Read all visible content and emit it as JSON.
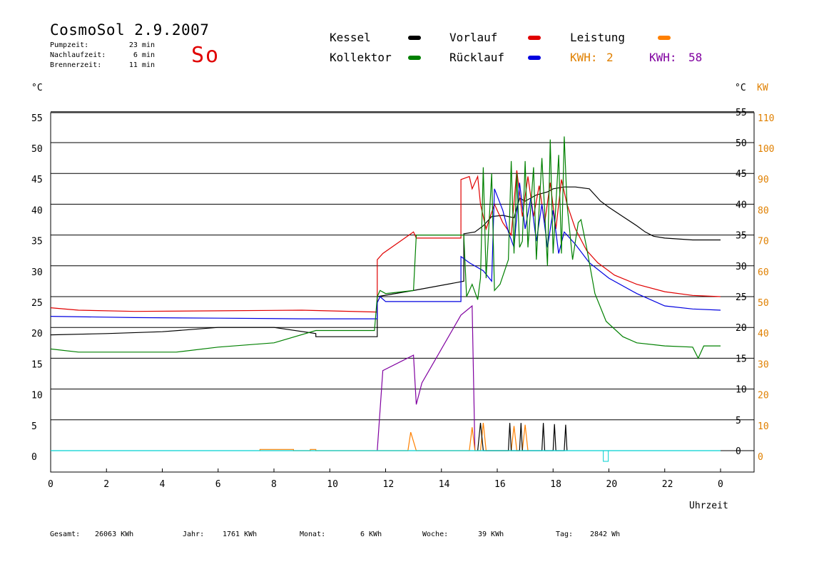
{
  "header": {
    "title": "CosmoSol 2.9.2007",
    "day": "So",
    "stats": [
      {
        "label": "Pumpzeit:",
        "value": "23 min"
      },
      {
        "label": "Nachlaufzeit:",
        "value": "6 min"
      },
      {
        "label": "Brennerzeit:",
        "value": "11 min"
      }
    ]
  },
  "legend": {
    "kessel": {
      "label": "Kessel",
      "color": "#000000"
    },
    "vorlauf": {
      "label": "Vorlauf",
      "color": "#e00000"
    },
    "leistung": {
      "label": "Leistung",
      "color": "#ff8000"
    },
    "kollektor": {
      "label": "Kollektor",
      "color": "#008000"
    },
    "ruecklauf": {
      "label": "Rücklauf",
      "color": "#0000e0"
    },
    "kwh_orange": {
      "label": "KWH:",
      "value": "2",
      "color": "#e08000"
    },
    "kwh_purple": {
      "label": "KWH:",
      "value": "58",
      "color": "#8000a0"
    }
  },
  "axes": {
    "left_unit": "°C",
    "right_unit": "°C",
    "right_unit2": "KW",
    "xlabel": "Uhrzeit"
  },
  "footer": {
    "gesamt": {
      "label": "Gesamt:",
      "value": "26063 KWh"
    },
    "jahr": {
      "label": "Jahr:",
      "value": "1761 KWh"
    },
    "monat": {
      "label": "Monat:",
      "value": "6 KWh"
    },
    "woche": {
      "label": "Woche:",
      "value": "39 KWh"
    },
    "tag": {
      "label": "Tag:",
      "value": "2842 Wh"
    }
  },
  "chart_data": {
    "type": "line",
    "xlim": [
      0,
      24
    ],
    "ylim": [
      -3.5,
      55
    ],
    "y2lim": [
      -7,
      110
    ],
    "x_ticks": [
      "0",
      "2",
      "4",
      "6",
      "8",
      "10",
      "12",
      "14",
      "16",
      "18",
      "20",
      "22",
      "0"
    ],
    "y_ticks": [
      0,
      5,
      10,
      15,
      20,
      25,
      30,
      35,
      40,
      45,
      50,
      55
    ],
    "y2_ticks": [
      0,
      10,
      20,
      30,
      40,
      50,
      60,
      70,
      80,
      90,
      100,
      110
    ],
    "grid": true,
    "series": [
      {
        "name": "Kessel",
        "color": "#000000",
        "points": [
          [
            0,
            18.8
          ],
          [
            2,
            19
          ],
          [
            4,
            19.3
          ],
          [
            6,
            20
          ],
          [
            8,
            20
          ],
          [
            9.5,
            19
          ],
          [
            9.5,
            18.5
          ],
          [
            11.7,
            18.5
          ],
          [
            11.7,
            25
          ],
          [
            13,
            26
          ],
          [
            14.8,
            27.5
          ],
          [
            14.8,
            35.2
          ],
          [
            15.2,
            35.5
          ],
          [
            15.5,
            36.5
          ],
          [
            15.8,
            38
          ],
          [
            16.2,
            38.2
          ],
          [
            16.6,
            37.8
          ],
          [
            16.8,
            41
          ],
          [
            17,
            40.5
          ],
          [
            17.4,
            41.5
          ],
          [
            17.8,
            42
          ],
          [
            18,
            42.5
          ],
          [
            18.4,
            42.8
          ],
          [
            18.8,
            42.8
          ],
          [
            19.3,
            42.5
          ],
          [
            19.5,
            41.5
          ],
          [
            19.7,
            40.5
          ],
          [
            20,
            39.5
          ],
          [
            20.5,
            38
          ],
          [
            21,
            36.5
          ],
          [
            21.3,
            35.5
          ],
          [
            21.6,
            34.8
          ],
          [
            22,
            34.5
          ],
          [
            23,
            34.2
          ],
          [
            24,
            34.2
          ]
        ]
      },
      {
        "name": "Vorlauf",
        "color": "#e00000",
        "points": [
          [
            0,
            23.2
          ],
          [
            1,
            22.8
          ],
          [
            3,
            22.6
          ],
          [
            6,
            22.7
          ],
          [
            9,
            22.8
          ],
          [
            11.7,
            22.5
          ],
          [
            11.7,
            31
          ],
          [
            11.9,
            32
          ],
          [
            13,
            35.5
          ],
          [
            13.1,
            34.5
          ],
          [
            14.7,
            34.5
          ],
          [
            14.7,
            44
          ],
          [
            15,
            44.5
          ],
          [
            15.1,
            42.5
          ],
          [
            15.3,
            44.5
          ],
          [
            15.4,
            40
          ],
          [
            15.6,
            36
          ],
          [
            15.9,
            40
          ],
          [
            16.2,
            37
          ],
          [
            16.5,
            35
          ],
          [
            16.7,
            45.5
          ],
          [
            16.9,
            38
          ],
          [
            17.1,
            44.5
          ],
          [
            17.3,
            38
          ],
          [
            17.5,
            43
          ],
          [
            17.7,
            37
          ],
          [
            17.9,
            43.5
          ],
          [
            18.1,
            36
          ],
          [
            18.3,
            44
          ],
          [
            18.5,
            40
          ],
          [
            18.8,
            36
          ],
          [
            19.2,
            32.5
          ],
          [
            19.6,
            30.5
          ],
          [
            20.2,
            28.5
          ],
          [
            21,
            27
          ],
          [
            22,
            25.8
          ],
          [
            23,
            25.2
          ],
          [
            24,
            25
          ]
        ]
      },
      {
        "name": "Rücklauf",
        "color": "#0000e0",
        "points": [
          [
            0,
            21.8
          ],
          [
            3,
            21.6
          ],
          [
            6,
            21.5
          ],
          [
            9,
            21.4
          ],
          [
            11.7,
            21.4
          ],
          [
            11.7,
            24
          ],
          [
            11.8,
            25
          ],
          [
            12,
            24.2
          ],
          [
            13,
            24.2
          ],
          [
            14.7,
            24.2
          ],
          [
            14.7,
            31.5
          ],
          [
            15,
            30.5
          ],
          [
            15.5,
            29.2
          ],
          [
            15.8,
            27.5
          ],
          [
            15.9,
            42.5
          ],
          [
            16.2,
            39
          ],
          [
            16.4,
            35.5
          ],
          [
            16.6,
            33
          ],
          [
            16.8,
            43.5
          ],
          [
            17,
            36
          ],
          [
            17.2,
            41
          ],
          [
            17.4,
            34
          ],
          [
            17.6,
            40
          ],
          [
            17.8,
            33
          ],
          [
            18,
            39
          ],
          [
            18.2,
            32
          ],
          [
            18.4,
            35.5
          ],
          [
            18.8,
            33.5
          ],
          [
            19.3,
            30.5
          ],
          [
            20,
            28
          ],
          [
            21,
            25.5
          ],
          [
            22,
            23.5
          ],
          [
            23,
            23
          ],
          [
            24,
            22.8
          ]
        ]
      },
      {
        "name": "Kollektor",
        "color": "#008000",
        "points": [
          [
            0,
            16.5
          ],
          [
            1,
            16
          ],
          [
            2,
            16
          ],
          [
            4.5,
            16
          ],
          [
            6,
            16.8
          ],
          [
            8,
            17.5
          ],
          [
            9.5,
            19.5
          ],
          [
            11.6,
            19.5
          ],
          [
            11.7,
            25
          ],
          [
            11.8,
            26
          ],
          [
            12,
            25.5
          ],
          [
            13,
            26
          ],
          [
            13.1,
            35
          ],
          [
            14.7,
            35
          ],
          [
            14.8,
            35
          ],
          [
            14.9,
            25
          ],
          [
            15.1,
            27
          ],
          [
            15.3,
            24.5
          ],
          [
            15.4,
            28
          ],
          [
            15.5,
            46
          ],
          [
            15.6,
            28
          ],
          [
            15.8,
            45
          ],
          [
            15.9,
            26
          ],
          [
            16.1,
            27
          ],
          [
            16.4,
            31
          ],
          [
            16.5,
            47
          ],
          [
            16.6,
            32
          ],
          [
            16.7,
            45
          ],
          [
            16.8,
            33
          ],
          [
            16.9,
            34
          ],
          [
            17,
            47
          ],
          [
            17.1,
            33
          ],
          [
            17.3,
            46
          ],
          [
            17.4,
            31
          ],
          [
            17.6,
            47.5
          ],
          [
            17.8,
            30
          ],
          [
            17.9,
            50.5
          ],
          [
            18,
            32
          ],
          [
            18.2,
            48
          ],
          [
            18.3,
            32
          ],
          [
            18.4,
            51
          ],
          [
            18.5,
            40
          ],
          [
            18.7,
            31
          ],
          [
            18.9,
            37
          ],
          [
            19,
            37.5
          ],
          [
            19.2,
            33
          ],
          [
            19.5,
            25.5
          ],
          [
            19.9,
            21
          ],
          [
            20.5,
            18.5
          ],
          [
            21,
            17.5
          ],
          [
            22,
            17
          ],
          [
            23,
            16.8
          ],
          [
            23.2,
            15
          ],
          [
            23.4,
            17
          ],
          [
            24,
            17
          ]
        ]
      },
      {
        "name": "Leistung_line",
        "color": "#8000a0",
        "points": [
          [
            11.7,
            0
          ],
          [
            11.9,
            13
          ],
          [
            13,
            15.5
          ],
          [
            13.1,
            7.5
          ],
          [
            13.3,
            11
          ],
          [
            14.7,
            22
          ],
          [
            15.1,
            23.5
          ],
          [
            15.2,
            0
          ]
        ]
      },
      {
        "name": "Leistung_spikes",
        "color": "#ff8000",
        "points": [
          [
            7.5,
            0
          ],
          [
            7.5,
            0.2
          ],
          [
            8.7,
            0.2
          ],
          [
            8.7,
            0
          ],
          [
            9.3,
            0
          ],
          [
            9.3,
            0.2
          ],
          [
            9.5,
            0.2
          ],
          [
            9.5,
            0
          ],
          [
            12.8,
            0
          ],
          [
            12.9,
            3
          ],
          [
            13.1,
            0
          ],
          [
            15.0,
            0
          ],
          [
            15.1,
            3.8
          ],
          [
            15.2,
            0
          ],
          [
            15.4,
            0
          ],
          [
            15.5,
            4.5
          ],
          [
            15.6,
            0
          ],
          [
            16.5,
            0
          ],
          [
            16.6,
            4
          ],
          [
            16.7,
            0
          ],
          [
            16.9,
            0
          ],
          [
            17.0,
            4.2
          ],
          [
            17.1,
            0
          ]
        ]
      },
      {
        "name": "Black_spikes",
        "color": "#000000",
        "points": [
          [
            15.3,
            0
          ],
          [
            15.4,
            4.5
          ],
          [
            15.5,
            0
          ],
          [
            16.4,
            0
          ],
          [
            16.45,
            4.5
          ],
          [
            16.5,
            0
          ],
          [
            16.8,
            0
          ],
          [
            16.85,
            4.5
          ],
          [
            16.9,
            0
          ],
          [
            17.6,
            0
          ],
          [
            17.65,
            4.5
          ],
          [
            17.7,
            0
          ],
          [
            18.0,
            0
          ],
          [
            18.05,
            4.3
          ],
          [
            18.1,
            0
          ],
          [
            18.4,
            0
          ],
          [
            18.45,
            4.2
          ],
          [
            18.5,
            0
          ]
        ]
      },
      {
        "name": "Baseline",
        "color": "#00d0d0",
        "points": [
          [
            0,
            0
          ],
          [
            24,
            0
          ]
        ]
      }
    ]
  }
}
